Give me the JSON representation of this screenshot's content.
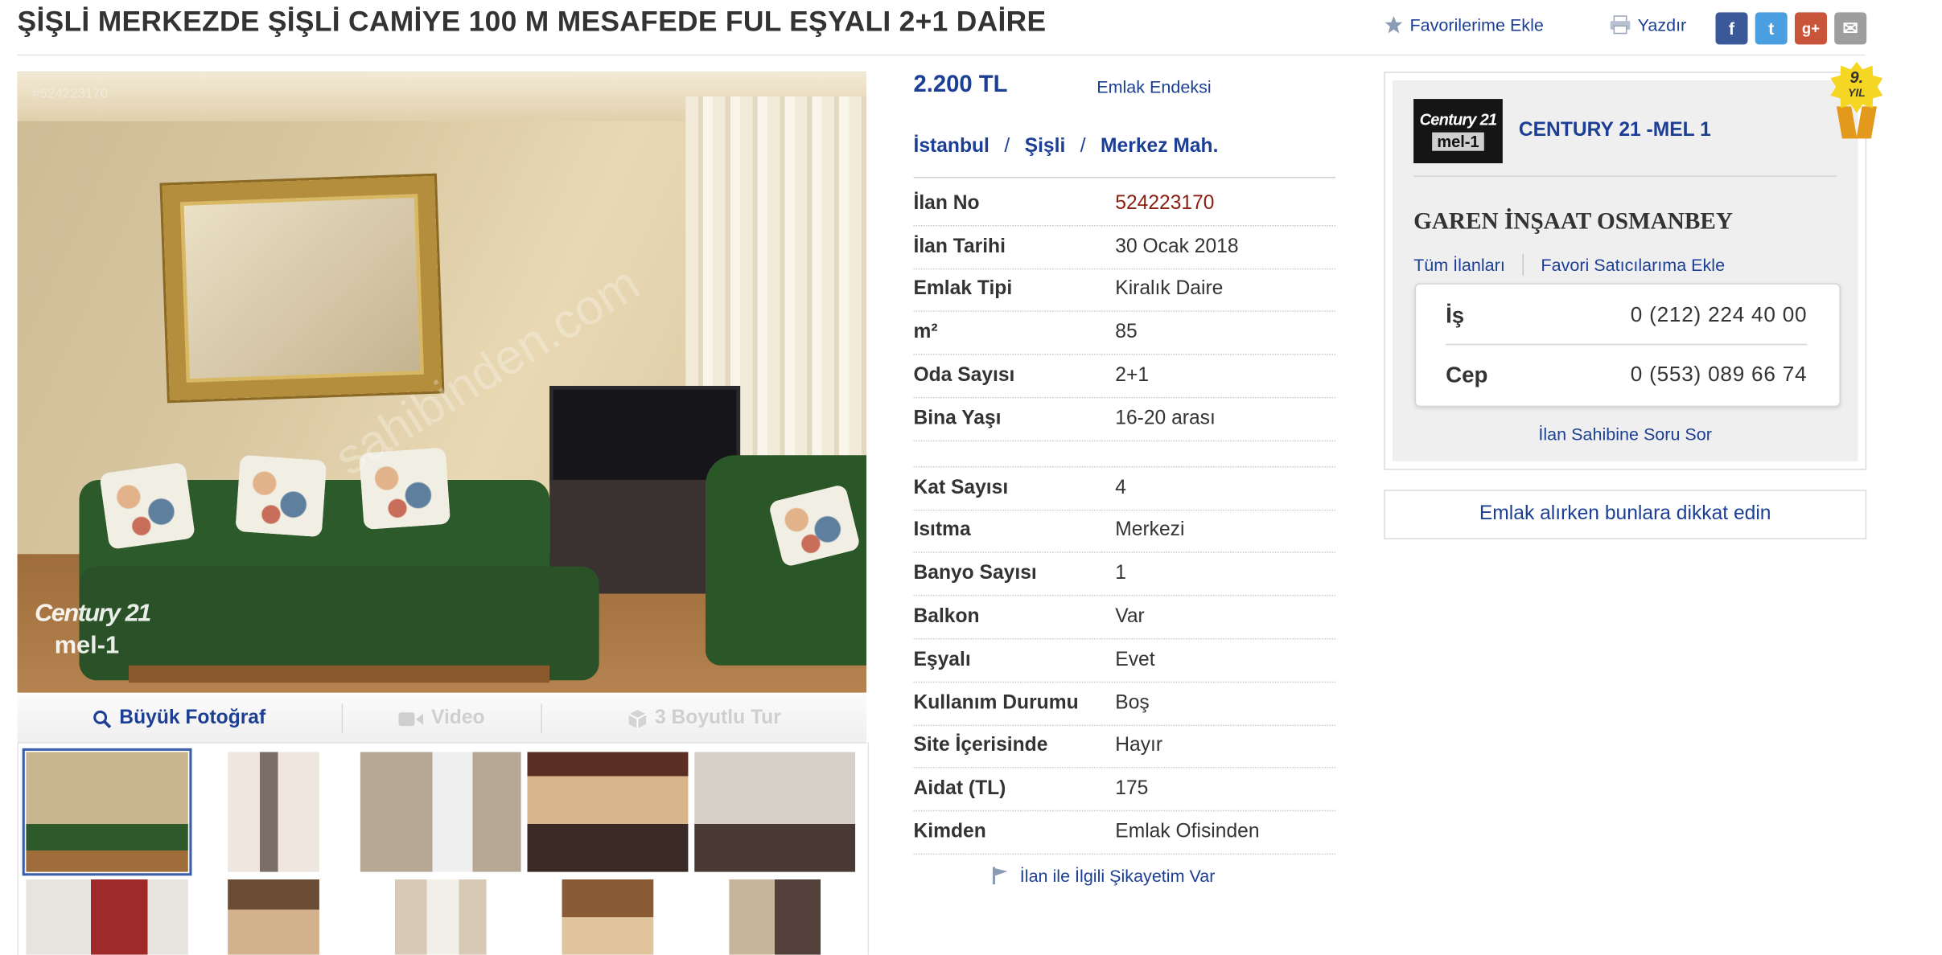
{
  "listing": {
    "title": "ŞİŞLİ MERKEZDE ŞİŞLİ CAMİYE 100 M MESAFEDE FUL EŞYALI 2+1 DAİRE",
    "price": "2.200 TL",
    "emlak_endeksi": "Emlak Endeksi",
    "location": [
      "İstanbul",
      "Şişli",
      "Merkez Mah."
    ],
    "complaint": "İlan ile İlgili Şikayetim Var"
  },
  "actions": {
    "favorite": "Favorilerime Ekle",
    "print": "Yazdır",
    "share": [
      {
        "icon": "facebook-icon",
        "glyph": "f",
        "color": "#3b5998"
      },
      {
        "icon": "twitter-icon",
        "glyph": "t",
        "color": "#4a9fe0"
      },
      {
        "icon": "google-plus-icon",
        "glyph": "g+",
        "color": "#c8553a"
      },
      {
        "icon": "email-icon",
        "glyph": "✉",
        "color": "#9e9e9e"
      }
    ]
  },
  "photo": {
    "photo_id_overlay": "#524223170",
    "watermark": "sahibinden.com",
    "logo_top": "Century 21",
    "logo_bottom": "mel-1"
  },
  "media_tabs": [
    {
      "label": "Büyük Fotoğraf",
      "icon": "search-icon",
      "enabled": true
    },
    {
      "label": "Video",
      "icon": "video-camera-icon",
      "enabled": false
    },
    {
      "label": "3 Boyutlu Tur",
      "icon": "cube-icon",
      "enabled": false
    }
  ],
  "thumbnails": [
    {
      "colors": [
        "#c9b58e",
        "#2e5a2b"
      ]
    },
    {
      "colors": [
        "#efe7df",
        "#7a6e66"
      ]
    },
    {
      "colors": [
        "#b7a896",
        "#efefef"
      ]
    },
    {
      "colors": [
        "#5a2e22",
        "#d8b48a"
      ]
    },
    {
      "colors": [
        "#d6d0c8",
        "#4a3a36"
      ]
    },
    {
      "colors": [
        "#e7e3df",
        "#9e2a2a"
      ]
    },
    {
      "colors": [
        "#6a4c34",
        "#d2b18c"
      ]
    },
    {
      "colors": [
        "#d7c9b4",
        "#f2efe8"
      ]
    },
    {
      "colors": [
        "#8b5b36",
        "#e0c49e"
      ]
    },
    {
      "colors": [
        "#c7b59b",
        "#54403a"
      ]
    }
  ],
  "info": [
    {
      "key": "İlan No",
      "value": "524223170",
      "accent": true
    },
    {
      "key": "İlan Tarihi",
      "value": "30 Ocak 2018"
    },
    {
      "key": "Emlak Tipi",
      "value": "Kiralık Daire"
    },
    {
      "key": "m²",
      "value": "85"
    },
    {
      "key": "Oda Sayısı",
      "value": "2+1"
    },
    {
      "key": "Bina Yaşı",
      "value": "16-20 arası"
    },
    {
      "key": "Kat Sayısı",
      "value": "4"
    },
    {
      "key": "Isıtma",
      "value": "Merkezi"
    },
    {
      "key": "Banyo Sayısı",
      "value": "1"
    },
    {
      "key": "Balkon",
      "value": "Var"
    },
    {
      "key": "Eşyalı",
      "value": "Evet"
    },
    {
      "key": "Kullanım Durumu",
      "value": "Boş"
    },
    {
      "key": "Site İçerisinde",
      "value": "Hayır"
    },
    {
      "key": "Aidat (TL)",
      "value": "175"
    },
    {
      "key": "Kimden",
      "value": "Emlak Ofisinden"
    }
  ],
  "seller": {
    "logo_top": "Century 21",
    "logo_bottom": "mel-1",
    "name": "CENTURY 21 -MEL 1",
    "badge_years": "9.",
    "badge_label": "YIL",
    "company": "GAREN İNŞAAT OSMANBEY",
    "all_listings": "Tüm İlanları",
    "add_favorite_seller": "Favori Satıcılarıma Ekle",
    "phones": [
      {
        "label": "İş",
        "number": "0 (212) 224 40 00"
      },
      {
        "label": "Cep",
        "number": "0 (553) 089 66 74"
      }
    ],
    "ask": "İlan Sahibine Soru Sor"
  },
  "advice": "Emlak alırken bunlara dikkat edin",
  "colors": {
    "link": "#1c3f95",
    "accent_red": "#8a1f11"
  }
}
